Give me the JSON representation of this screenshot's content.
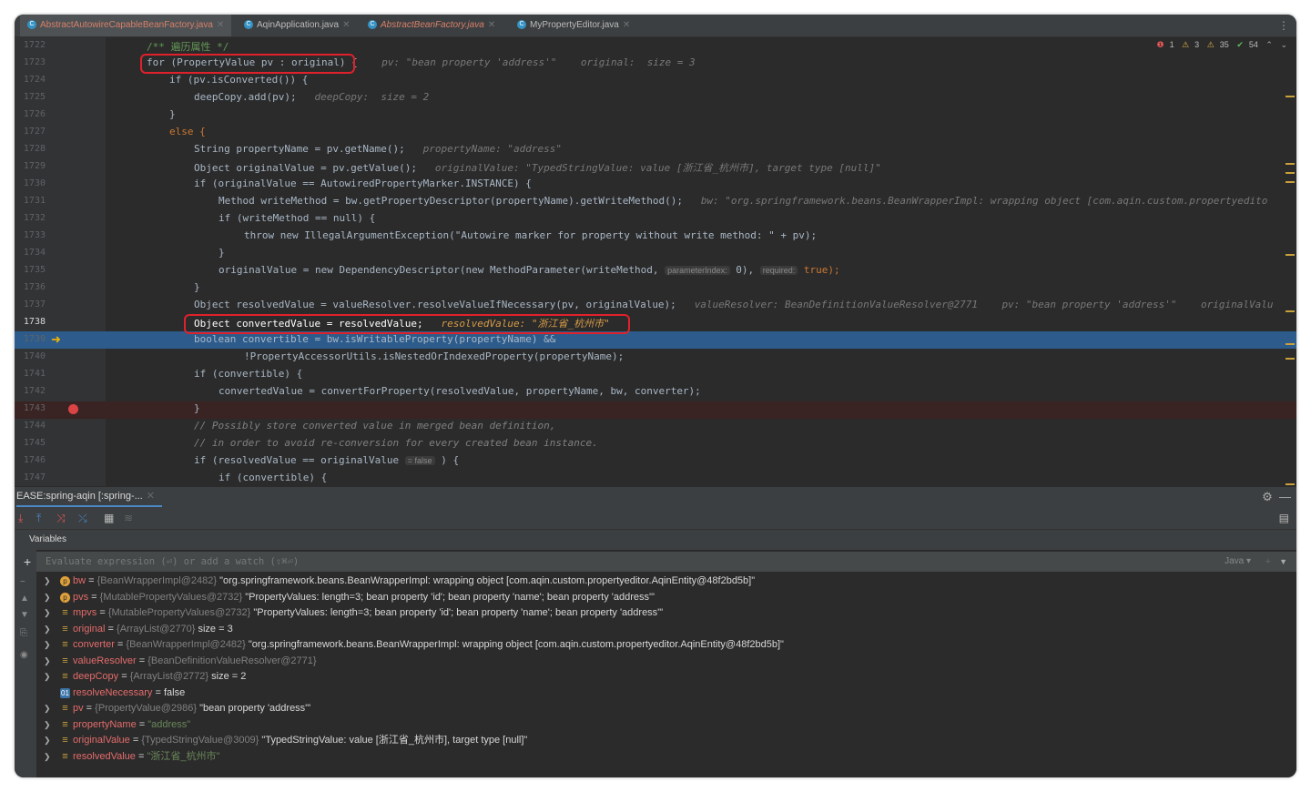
{
  "tabs": [
    {
      "name": "AbstractAutowireCapableBeanFactory.java",
      "active": true
    },
    {
      "name": "AqinApplication.java",
      "active": false
    },
    {
      "name": "AbstractBeanFactory.java",
      "active": false
    },
    {
      "name": "MyPropertyEditor.java",
      "active": false
    }
  ],
  "status": {
    "errors": "1",
    "warn1": "3",
    "warn2": "35",
    "ok": "54"
  },
  "line_numbers": [
    "1722",
    "1723",
    "1724",
    "1725",
    "1726",
    "1727",
    "1728",
    "1729",
    "1730",
    "1731",
    "1732",
    "1733",
    "1734",
    "1735",
    "1736",
    "1737",
    "1738",
    "1739",
    "1740",
    "1741",
    "1742",
    "1743",
    "1744",
    "1745",
    "1746",
    "1747"
  ],
  "code": {
    "l1722": "/** 遍历属性 */",
    "l1723_code": "for (PropertyValue pv : original) {",
    "l1723_hint": "pv: \"bean property 'address'\"    original:  size = 3",
    "l1724": "if (pv.isConverted()) {",
    "l1725_code": "deepCopy.add(pv);",
    "l1725_hint": "deepCopy:  size = 2",
    "l1726": "}",
    "l1727": "else {",
    "l1728_code": "String propertyName = pv.getName();",
    "l1728_hint": "propertyName: \"address\"",
    "l1729_code": "Object originalValue = pv.getValue();",
    "l1729_hint": "originalValue: \"TypedStringValue: value [浙江省_杭州市], target type [null]\"",
    "l1730": "if (originalValue == AutowiredPropertyMarker.INSTANCE) {",
    "l1731_code": "Method writeMethod = bw.getPropertyDescriptor(propertyName).getWriteMethod();",
    "l1731_hint": "bw: \"org.springframework.beans.BeanWrapperImpl: wrapping object [com.aqin.custom.propertyedito",
    "l1732": "if (writeMethod == null) {",
    "l1733": "throw new IllegalArgumentException(\"Autowire marker for property without write method: \" + pv);",
    "l1734": "}",
    "l1735_a": "originalValue = new DependencyDescriptor(new MethodParameter(writeMethod,",
    "l1735_hint1": "parameterIndex:",
    "l1735_b": "0),",
    "l1735_hint2": "required:",
    "l1735_c": "true);",
    "l1736": "}",
    "l1737_code": "Object resolvedValue = valueResolver.resolveValueIfNecessary(pv, originalValue);",
    "l1737_hint": "valueResolver: BeanDefinitionValueResolver@2771    pv: \"bean property 'address'\"    originalValu",
    "l1738_code": "Object convertedValue = resolvedValue;",
    "l1738_hint": "resolvedValue: \"浙江省_杭州市\"",
    "l1739": "boolean convertible = bw.isWritableProperty(propertyName) &&",
    "l1740": "!PropertyAccessorUtils.isNestedOrIndexedProperty(propertyName);",
    "l1741": "if (convertible) {",
    "l1742": "convertedValue = convertForProperty(resolvedValue, propertyName, bw, converter);",
    "l1743": "}",
    "l1744": "// Possibly store converted value in merged bean definition,",
    "l1745": "// in order to avoid re-conversion for every created bean instance.",
    "l1746_code": "if (resolvedValue == originalValue",
    "l1746_hint": "= false",
    "l1746_end": ") {",
    "l1747": "if (convertible) {"
  },
  "debug": {
    "tab_label": "EASE:spring-aqin [:spring-...",
    "section_label": "Variables",
    "eval_placeholder": "Evaluate expression (⏎) or add a watch (⇧⌘⏎)",
    "lang": "Java ▾",
    "variables": [
      {
        "icon": "p",
        "name": "bw",
        "ref": "{BeanWrapperImpl@2482}",
        "val": "\"org.springframework.beans.BeanWrapperImpl: wrapping object [com.aqin.custom.propertyeditor.AqinEntity@48f2bd5b]\"",
        "type": "val",
        "expand": true
      },
      {
        "icon": "p",
        "name": "pvs",
        "ref": "{MutablePropertyValues@2732}",
        "val": "\"PropertyValues: length=3; bean property 'id'; bean property 'name'; bean property 'address'\"",
        "type": "val",
        "expand": true
      },
      {
        "icon": "l",
        "name": "mpvs",
        "ref": "{MutablePropertyValues@2732}",
        "val": "\"PropertyValues: length=3; bean property 'id'; bean property 'name'; bean property 'address'\"",
        "type": "val",
        "expand": true
      },
      {
        "icon": "l",
        "name": "original",
        "ref": "{ArrayList@2770}",
        "val": " size = 3",
        "type": "val",
        "expand": true
      },
      {
        "icon": "l",
        "name": "converter",
        "ref": "{BeanWrapperImpl@2482}",
        "val": "\"org.springframework.beans.BeanWrapperImpl: wrapping object [com.aqin.custom.propertyeditor.AqinEntity@48f2bd5b]\"",
        "type": "val",
        "expand": true
      },
      {
        "icon": "l",
        "name": "valueResolver",
        "ref": "{BeanDefinitionValueResolver@2771}",
        "val": "",
        "type": "val",
        "expand": true
      },
      {
        "icon": "l",
        "name": "deepCopy",
        "ref": "{ArrayList@2772}",
        "val": " size = 2",
        "type": "val",
        "expand": true
      },
      {
        "icon": "b",
        "name": "resolveNecessary",
        "ref": "",
        "val": "false",
        "type": "val",
        "expand": false
      },
      {
        "icon": "l",
        "name": "pv",
        "ref": "{PropertyValue@2986}",
        "val": "\"bean property 'address'\"",
        "type": "val",
        "expand": true
      },
      {
        "icon": "l",
        "name": "propertyName",
        "ref": "",
        "val": "\"address\"",
        "type": "str",
        "expand": true
      },
      {
        "icon": "l",
        "name": "originalValue",
        "ref": "{TypedStringValue@3009}",
        "val": "\"TypedStringValue: value [浙江省_杭州市], target type [null]\"",
        "type": "val",
        "expand": true
      },
      {
        "icon": "l",
        "name": "resolvedValue",
        "ref": "",
        "val": "\"浙江省_杭州市\"",
        "type": "str",
        "expand": true
      }
    ]
  }
}
